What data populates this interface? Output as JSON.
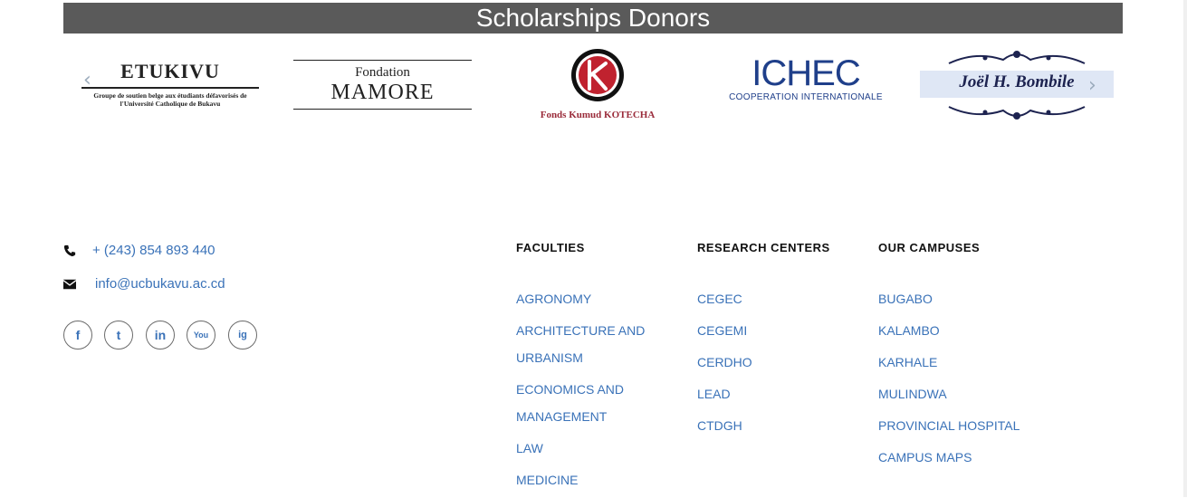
{
  "donors": {
    "title": "Scholarships Donors",
    "logos": [
      {
        "name": "ETUKIVU",
        "subtitle_line1": "Groupe de soutien belge aux étudiants défavorisés de",
        "subtitle_line2": "l'Université Catholique de Bukavu"
      },
      {
        "name_line1": "Fondation",
        "name_line2": "MAMORE"
      },
      {
        "name": "Fonds Kumud KOTECHA"
      },
      {
        "name": "ICHEC",
        "subtitle": "COOPERATION INTERNATIONALE"
      },
      {
        "name": "Joël H. Bombile"
      }
    ],
    "prev_arrow": "‹",
    "next_arrow": "›"
  },
  "contact": {
    "phone": "+ (243) 854 893 440",
    "email": "info@ucbukavu.ac.cd",
    "socials": [
      {
        "icon": "facebook-icon",
        "glyph": "f"
      },
      {
        "icon": "twitter-icon",
        "glyph": "t"
      },
      {
        "icon": "linkedin-icon",
        "glyph": "in"
      },
      {
        "icon": "youtube-icon",
        "glyph": "You"
      },
      {
        "icon": "instagram-icon",
        "glyph": "ig"
      }
    ]
  },
  "footer": {
    "faculties": {
      "heading": "FACULTIES",
      "items": [
        [
          "AGRONOMY"
        ],
        [
          "ARCHITECTURE AND",
          "URBANISM"
        ],
        [
          "ECONOMICS AND",
          "MANAGEMENT"
        ],
        [
          "LAW"
        ],
        [
          "MEDICINE"
        ]
      ]
    },
    "research": {
      "heading": "RESEARCH CENTERS",
      "items": [
        "CEGEC",
        "CEGEMI",
        "CERDHO",
        "LEAD",
        "CTDGH"
      ]
    },
    "campuses": {
      "heading": "OUR CAMPUSES",
      "items": [
        "BUGABO",
        "KALAMBO",
        "KARHALE",
        "MULINDWA",
        "PROVINCIAL HOSPITAL",
        "CAMPUS MAPS"
      ]
    }
  },
  "colors": {
    "banner": "#5a5a5a",
    "link": "#3a72b8",
    "ichec": "#1f3f8a",
    "kotecha": "#9a2b3a"
  }
}
